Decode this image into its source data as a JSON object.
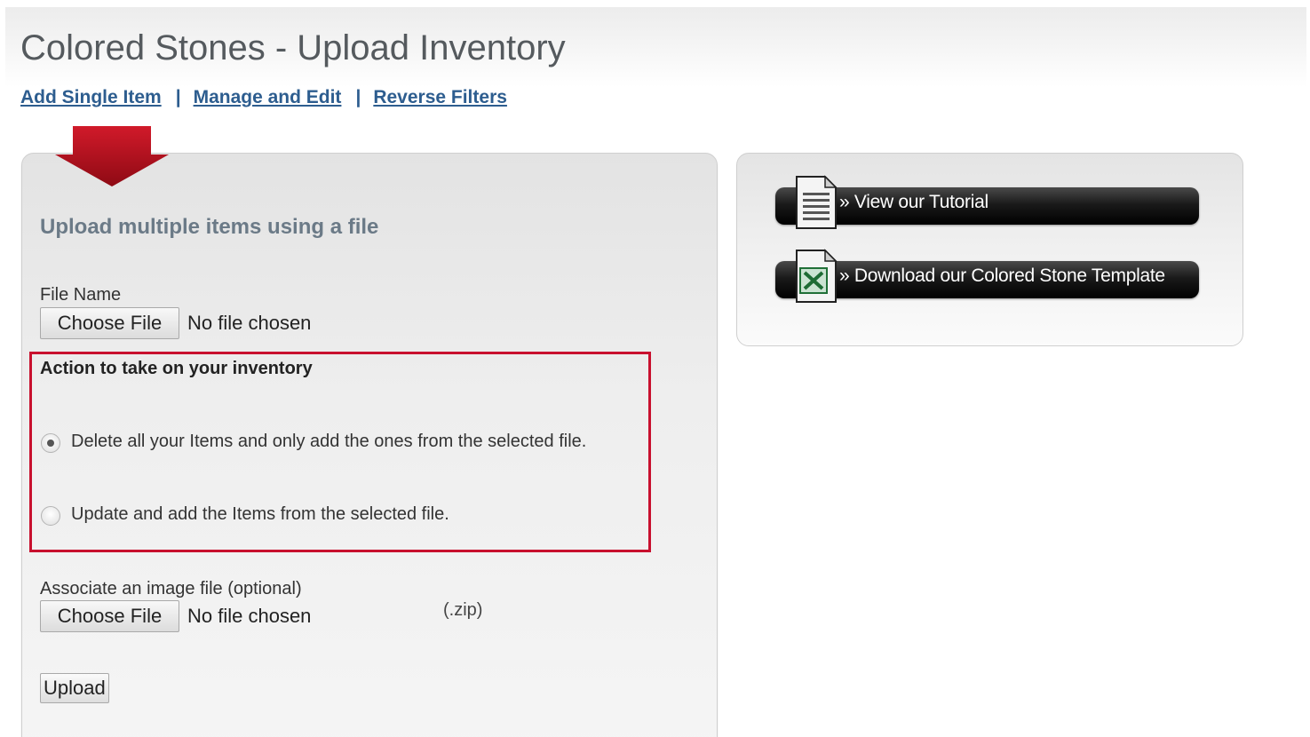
{
  "header": {
    "title": "Colored Stones - Upload Inventory"
  },
  "nav": {
    "items": [
      {
        "label": "Add Single Item"
      },
      {
        "label": "Manage and Edit"
      },
      {
        "label": "Reverse Filters"
      }
    ],
    "separator": "|"
  },
  "upload_panel": {
    "heading": "Upload multiple items using a file",
    "file_name_label": "File Name",
    "choose_file_label": "Choose File",
    "no_file_text": "No file chosen",
    "action_title": "Action to take on your inventory",
    "options": [
      {
        "label": "Delete all your Items and only add the ones from the selected file.",
        "checked": true
      },
      {
        "label": "Update and add the Items from the selected file.",
        "checked": false
      }
    ],
    "image_label": "Associate an image file (optional)",
    "image_choose_label": "Choose File",
    "image_no_file_text": "No file chosen",
    "zip_hint": "(.zip)",
    "upload_label": "Upload"
  },
  "resources_panel": {
    "tutorial_label": "» View our Tutorial",
    "template_label": "» Download our Colored Stone Template"
  },
  "colors": {
    "accent_red": "#c8102e",
    "link_blue": "#2d5d8f",
    "heading_gray": "#6b7a87",
    "icons": [
      "down-arrow-icon",
      "document-icon",
      "excel-icon"
    ]
  }
}
